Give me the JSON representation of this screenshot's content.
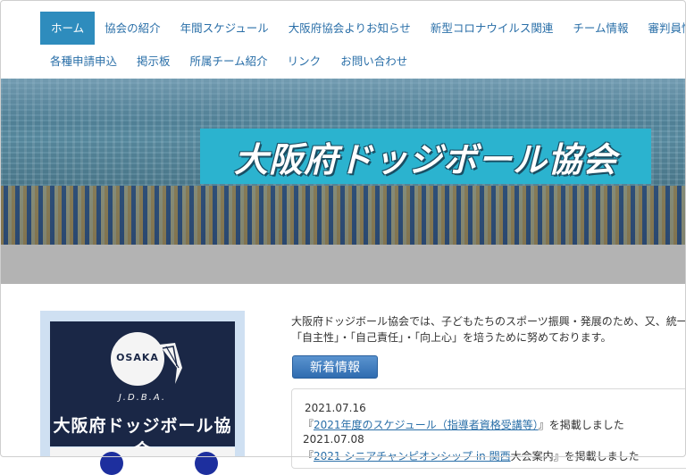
{
  "nav": {
    "row1": [
      "ホーム",
      "協会の紹介",
      "年間スケジュール",
      "大阪府協会よりお知らせ",
      "新型コロナウイルス関連",
      "チーム情報",
      "審判員情報"
    ],
    "row2": [
      "各種申請申込",
      "掲示板",
      "所属チーム紹介",
      "リンク",
      "お問い合わせ"
    ]
  },
  "hero": {
    "banner": "大阪府ドッジボール協会"
  },
  "logo": {
    "osaka": "OSAKA",
    "jdba": "J.D.B.A.",
    "name": "大阪府ドッジボール協会"
  },
  "intro": {
    "line1": "大阪府ドッジボール協会では、子どもたちのスポーツ振興・発展のため、又、統一",
    "line2": "「自主性」・「自己責任」・「向上心」を培うために努めております。"
  },
  "news": {
    "button": "新着情報",
    "items": [
      {
        "date": "2021.07.16",
        "open": "『",
        "link": "2021年度のスケジュール（指導者資格受講等）",
        "close": "』を掲載しました"
      },
      {
        "date": "2021.07.08",
        "open": "『",
        "link": "2021 シニアチャンピオンシップ in 関西",
        "close": "大会案内』を掲載しました"
      }
    ]
  },
  "colors": {
    "nav_active": "#2e8cbd",
    "banner": "#2bb3cf",
    "link": "#2a6fa8"
  }
}
